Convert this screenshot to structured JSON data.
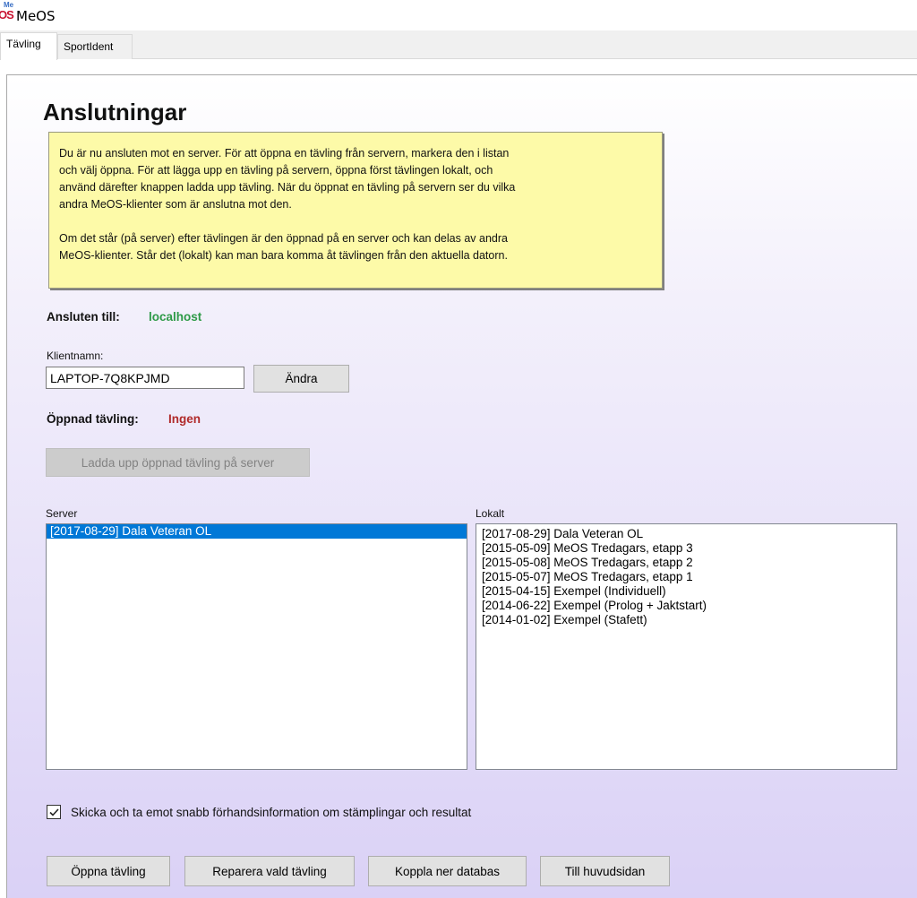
{
  "app": {
    "logo_top": "Me",
    "logo_bottom": "OS",
    "title": "MeOS"
  },
  "tabs": [
    {
      "label": "Tävling",
      "active": true
    },
    {
      "label": "SportIdent",
      "active": false
    }
  ],
  "page": {
    "title": "Anslutningar",
    "info_lines_1": [
      "Du är nu ansluten mot en server. För att öppna en tävling från servern, markera den i listan",
      "och välj öppna. För att lägga upp en tävling på servern, öppna först tävlingen lokalt, och",
      "använd därefter knappen ladda upp tävling. När du öppnat en tävling på servern ser du vilka",
      "andra MeOS-klienter som är anslutna mot den."
    ],
    "info_lines_2": [
      "Om det står (på server) efter tävlingen är den öppnad på en server och kan delas av andra",
      "MeOS-klienter. Står det (lokalt) kan man bara komma åt tävlingen från den aktuella datorn."
    ],
    "connected_label": "Ansluten till:",
    "connected_value": "localhost",
    "client_name_label": "Klientnamn:",
    "client_name_value": "LAPTOP-7Q8KPJMD",
    "change_button": "Ändra",
    "opened_label": "Öppnad tävling:",
    "opened_value": "Ingen",
    "upload_button": "Ladda upp öppnad tävling på server",
    "server_label": "Server",
    "local_label": "Lokalt",
    "checkbox_label": "Skicka och ta emot snabb förhandsinformation om stämplingar och resultat",
    "checkbox_checked": true
  },
  "server_list": [
    {
      "text": "[2017-08-29] Dala Veteran OL",
      "selected": true
    }
  ],
  "local_list": [
    {
      "text": "[2017-08-29] Dala Veteran OL",
      "selected": false
    },
    {
      "text": "[2015-05-09] MeOS Tredagars, etapp 3",
      "selected": false
    },
    {
      "text": "[2015-05-08] MeOS Tredagars, etapp 2",
      "selected": false
    },
    {
      "text": "[2015-05-07] MeOS Tredagars, etapp 1",
      "selected": false
    },
    {
      "text": "[2015-04-15] Exempel (Individuell)",
      "selected": false
    },
    {
      "text": "[2014-06-22] Exempel (Prolog + Jaktstart)",
      "selected": false
    },
    {
      "text": "[2014-01-02] Exempel (Stafett)",
      "selected": false
    }
  ],
  "bottom_buttons": {
    "open": "Öppna tävling",
    "repair": "Reparera vald tävling",
    "disconnect": "Koppla ner databas",
    "home": "Till huvudsidan"
  },
  "colors": {
    "accent_selected": "#0078d7",
    "connected_green": "#2e9a48",
    "none_red": "#b02a2a",
    "info_yellow": "#fdfaa8"
  }
}
